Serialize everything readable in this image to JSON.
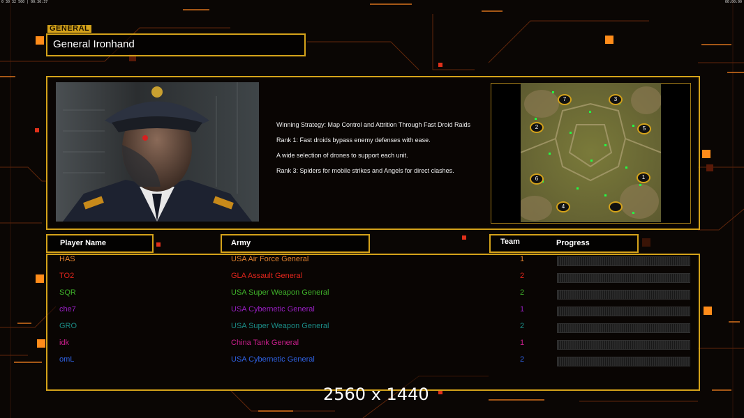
{
  "hud": {
    "top_left": "0 30 32 500 | 00:36:37",
    "top_right": "00:00:00"
  },
  "general": {
    "tag": "GENERAL",
    "name": "General Ironhand"
  },
  "strategy": {
    "lines": [
      "Winning Strategy: Map Control and Attrition Through Fast Droid Raids",
      "Rank 1: Fast droids bypass enemy defenses with ease.",
      "A wide selection of drones to support each unit.",
      "Rank 3: Spiders for mobile strikes and Angels for direct clashes."
    ]
  },
  "minimap": {
    "start_positions": [
      "7",
      "3",
      "2",
      "5",
      "6",
      "1",
      "4",
      ""
    ]
  },
  "columns": {
    "player_name": "Player Name",
    "army": "Army",
    "team": "Team",
    "progress": "Progress"
  },
  "players": [
    {
      "name": "HAS",
      "army": "USA Air Force General",
      "team": "1",
      "color": "#e2832f"
    },
    {
      "name": "TO2",
      "army": "GLA Assault General",
      "team": "2",
      "color": "#e0251c"
    },
    {
      "name": "SQR",
      "army": "USA Super Weapon General",
      "team": "2",
      "color": "#3fb22a"
    },
    {
      "name": "che7",
      "army": "USA Cybernetic General",
      "team": "1",
      "color": "#9a1fc4"
    },
    {
      "name": "GRO",
      "army": "USA Super Weapon General",
      "team": "2",
      "color": "#1b8c86"
    },
    {
      "name": "idk",
      "army": "China Tank General",
      "team": "1",
      "color": "#cc1f8e"
    },
    {
      "name": "omL",
      "army": "USA Cybernetic General",
      "team": "2",
      "color": "#2f62e3"
    }
  ],
  "resolution_label": "2560 x 1440",
  "colors": {
    "accent": "#d4a21a",
    "background": "#0a0604"
  }
}
